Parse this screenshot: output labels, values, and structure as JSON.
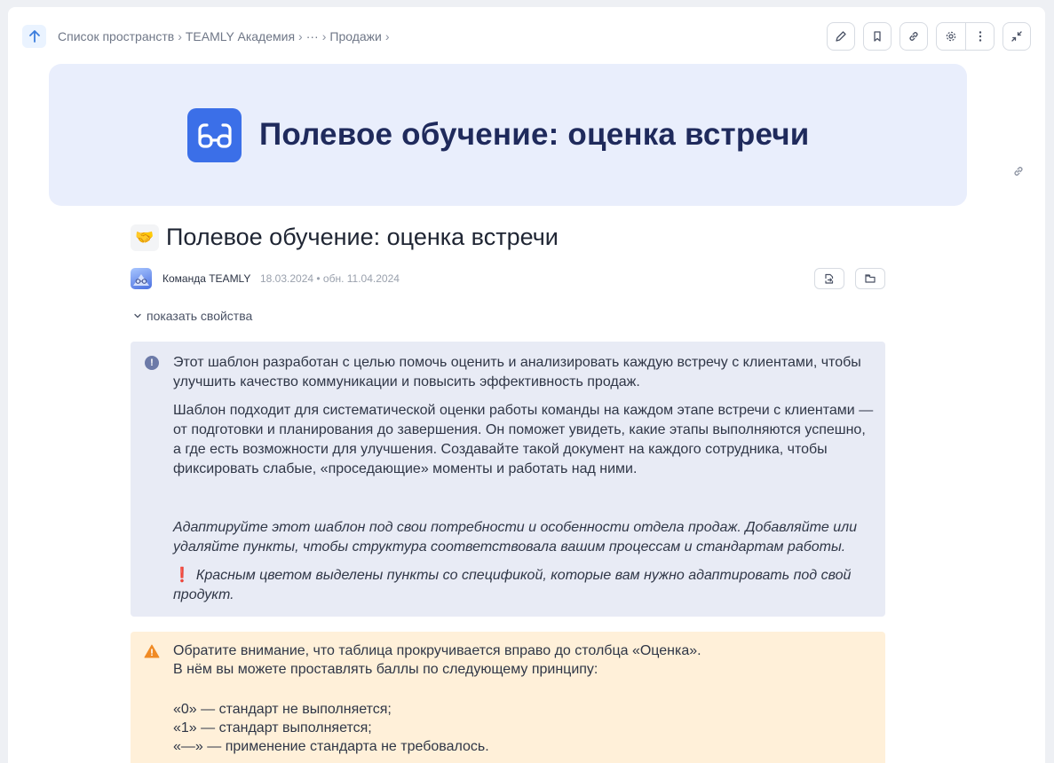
{
  "breadcrumbs": [
    "Список пространств",
    "TEAMLY Академия",
    "···",
    "Продажи"
  ],
  "cover": {
    "title": "Полевое обучение: оценка встречи"
  },
  "doc": {
    "emoji": "🤝",
    "title": "Полевое обучение: оценка встречи",
    "author": "Команда TEAMLY",
    "dates": "18.03.2024 • обн. 11.04.2024",
    "show_props": "показать свойства"
  },
  "info": {
    "p1": "Этот шаблон разработан с целью помочь оценить и анализировать каждую встречу с клиентами, чтобы улучшить качество коммуникации и повысить эффективность продаж.",
    "p2": "Шаблон подходит для систематической оценки работы команды на каждом этапе встречи с клиентами — от подготовки и планирования до завершения. Он поможет увидеть, какие этапы выполняются успешно, а где есть возможности для улучшения. Создавайте такой документ на каждого сотрудника, чтобы фиксировать слабые, «проседающие» моменты и работать над ними.",
    "p3": "Адаптируйте этот шаблон под свои потребности и особенности отдела продаж. Добавляйте или удаляйте пункты, чтобы структура соответствовала вашим процессам и стандартам работы.",
    "excl": "❗",
    "p4": "Красным цветом выделены пункты со спецификой, которые вам нужно адаптировать под свой продукт."
  },
  "warning": {
    "line1": "Обратите внимание, что таблица прокручивается вправо до столбца «Оценка».",
    "line2": "В нём вы можете проставлять баллы по следующему принципу:",
    "line3": "«0» — стандарт не выполняется;",
    "line4": "«1» — стандарт выполняется;",
    "line5": "«—» — применение стандарта не требовалось."
  }
}
